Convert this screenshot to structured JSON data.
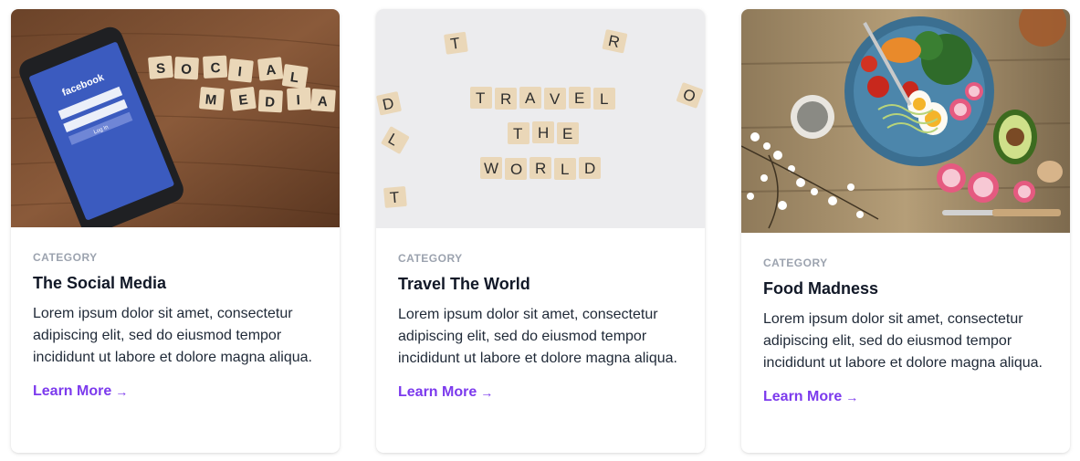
{
  "cards": [
    {
      "category": "CATEGORY",
      "title": "The Social Media",
      "description": "Lorem ipsum dolor sit amet, consectetur adipiscing elit, sed do eiusmod tempor incididunt ut labore et dolore magna aliqua.",
      "link_label": "Learn More",
      "arrow": "→",
      "image_tiles": [
        "S",
        "O",
        "C",
        "I",
        "A",
        "L",
        "M",
        "E",
        "D",
        "I",
        "A"
      ],
      "phone_brand": "facebook",
      "phone_login": "Log In"
    },
    {
      "category": "CATEGORY",
      "title": "Travel The World",
      "description": "Lorem ipsum dolor sit amet, consectetur adipiscing elit, sed do eiusmod tempor incididunt ut labore et dolore magna aliqua.",
      "link_label": "Learn More",
      "arrow": "→",
      "image_tiles": [
        "T",
        "R",
        "A",
        "V",
        "E",
        "L",
        "T",
        "H",
        "E",
        "W",
        "O",
        "R",
        "L",
        "D"
      ]
    },
    {
      "category": "CATEGORY",
      "title": "Food Madness",
      "description": "Lorem ipsum dolor sit amet, consectetur adipiscing elit, sed do eiusmod tempor incididunt ut labore et dolore magna aliqua.",
      "link_label": "Learn More",
      "arrow": "→"
    }
  ],
  "colors": {
    "accent": "#7c3aed",
    "category": "#9ca3af",
    "title": "#111827",
    "body": "#1f2937"
  }
}
